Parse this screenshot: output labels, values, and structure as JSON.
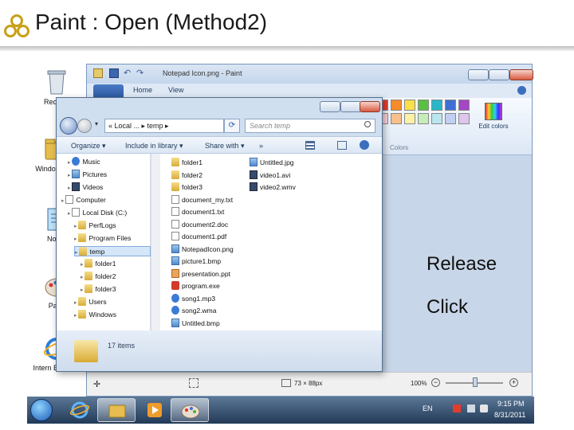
{
  "slide": {
    "title": "Paint : Open (Method2)"
  },
  "desktop_icons": [
    {
      "name": "recycle-bin",
      "label": "Recycle"
    },
    {
      "name": "windows-explorer",
      "label": "Windo Explor"
    },
    {
      "name": "notepad",
      "label": "Notep"
    },
    {
      "name": "paint",
      "label": "Paint"
    },
    {
      "name": "internet-explorer",
      "label": "Intern Explorer"
    }
  ],
  "paint": {
    "title": "Notepad Icon.png - Paint",
    "tabs": [
      "Home",
      "View"
    ],
    "edit_colors": "Edit colors",
    "colors_label": "Colors",
    "status": {
      "selection": "73 × 88px",
      "zoom": "100%"
    },
    "palette": [
      "#e43b2f",
      "#f78b2b",
      "#fbe04a",
      "#5ac042",
      "#28b6c8",
      "#3f6fd5",
      "#a546c4",
      "#fcd0d8",
      "#f8bf8a",
      "#fdf1a5",
      "#c6ecb9",
      "#b9e6ef",
      "#c1cff3",
      "#dec6ec"
    ]
  },
  "dialog": {
    "address": "« Local ... ▸ temp ▸",
    "search_placeholder": "Search temp",
    "toolbar": {
      "organize": "Organize ▾",
      "include": "Include in library ▾",
      "share": "Share with ▾",
      "more": "»"
    },
    "tree": [
      {
        "label": "Music",
        "indent": 1,
        "type": "music"
      },
      {
        "label": "Pictures",
        "indent": 1,
        "type": "pic"
      },
      {
        "label": "Videos",
        "indent": 1,
        "type": "vid"
      },
      {
        "label": "Computer",
        "indent": 0,
        "type": "pc"
      },
      {
        "label": "Local Disk (C:)",
        "indent": 1,
        "type": "disk"
      },
      {
        "label": "PerfLogs",
        "indent": 2,
        "type": "fold"
      },
      {
        "label": "Program Files",
        "indent": 2,
        "type": "fold"
      },
      {
        "label": "temp",
        "indent": 2,
        "type": "fold",
        "selected": true
      },
      {
        "label": "folder1",
        "indent": 3,
        "type": "fold"
      },
      {
        "label": "folder2",
        "indent": 3,
        "type": "fold"
      },
      {
        "label": "folder3",
        "indent": 3,
        "type": "fold"
      },
      {
        "label": "Users",
        "indent": 2,
        "type": "fold"
      },
      {
        "label": "Windows",
        "indent": 2,
        "type": "fold"
      }
    ],
    "files_col1": [
      {
        "label": "folder1",
        "type": "fold"
      },
      {
        "label": "folder2",
        "type": "fold"
      },
      {
        "label": "folder3",
        "type": "fold"
      },
      {
        "label": "document_my.txt",
        "type": "doc"
      },
      {
        "label": "document1.txt",
        "type": "doc"
      },
      {
        "label": "document2.doc",
        "type": "doc"
      },
      {
        "label": "document1.pdf",
        "type": "doc"
      },
      {
        "label": "NotepadIcon.png",
        "type": "img"
      },
      {
        "label": "picture1.bmp",
        "type": "img"
      },
      {
        "label": "presentation.ppt",
        "type": "ppt"
      },
      {
        "label": "program.exe",
        "type": "exe"
      },
      {
        "label": "song1.mp3",
        "type": "aud"
      },
      {
        "label": "song2.wma",
        "type": "aud"
      },
      {
        "label": "Untitled.bmp",
        "type": "img"
      }
    ],
    "files_col2": [
      {
        "label": "Untitled.jpg",
        "type": "img"
      },
      {
        "label": "video1.avi",
        "type": "vid"
      },
      {
        "label": "video2.wmv",
        "type": "vid"
      }
    ],
    "items_count": "17 items"
  },
  "callouts": {
    "release": "Release",
    "click": "Click"
  },
  "taskbar": {
    "lang": "EN",
    "time": "9:15 PM",
    "date": "8/31/2011"
  },
  "colors": {
    "accent": "#2c5aa3",
    "title_text": "#1a1a1a",
    "logo_gold": "#c8a018"
  }
}
